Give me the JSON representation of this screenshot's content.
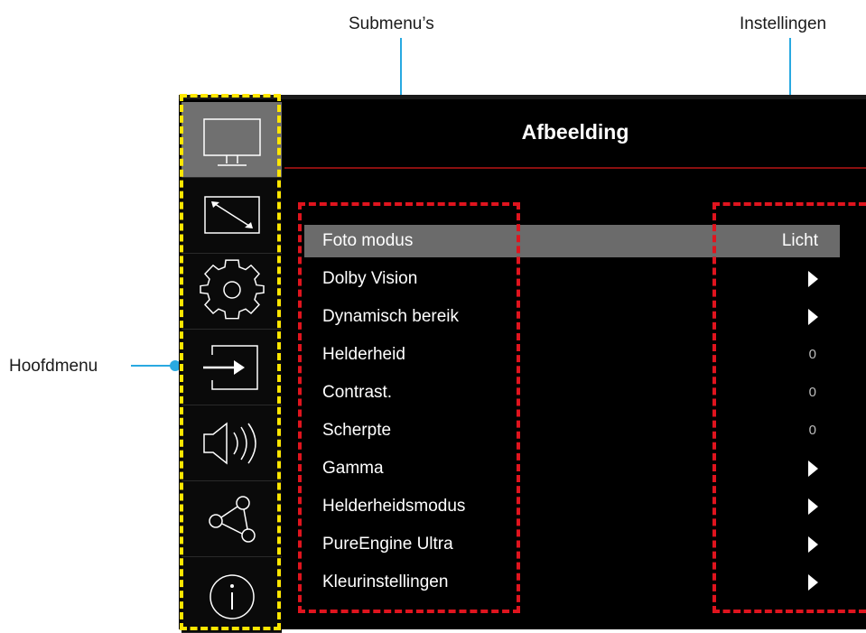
{
  "callouts": {
    "submenus": "Submenu’s",
    "settings": "Instellingen",
    "mainmenu": "Hoofdmenu"
  },
  "colors": {
    "callout": "#29a9e1",
    "mainmenu_frame": "#ffe600",
    "submenu_frame": "#e0141e",
    "selected_row": "#6b6b6b"
  },
  "sidebar": {
    "items": [
      {
        "icon": "monitor-icon",
        "active": true
      },
      {
        "icon": "resize-icon",
        "active": false
      },
      {
        "icon": "gear-icon",
        "active": false
      },
      {
        "icon": "input-icon",
        "active": false
      },
      {
        "icon": "speaker-icon",
        "active": false
      },
      {
        "icon": "network-icon",
        "active": false
      },
      {
        "icon": "info-icon",
        "active": false
      }
    ]
  },
  "menu": {
    "title": "Afbeelding",
    "rows": [
      {
        "label": "Foto modus",
        "value": "Licht",
        "selected": true
      },
      {
        "label": "Dolby Vision",
        "value": "arrow"
      },
      {
        "label": "Dynamisch bereik",
        "value": "arrow"
      },
      {
        "label": "Helderheid",
        "value": "0"
      },
      {
        "label": "Contrast.",
        "value": "0"
      },
      {
        "label": "Scherpte",
        "value": "0"
      },
      {
        "label": "Gamma",
        "value": "arrow"
      },
      {
        "label": "Helderheidsmodus",
        "value": "arrow"
      },
      {
        "label": "PureEngine Ultra",
        "value": "arrow"
      },
      {
        "label": "Kleurinstellingen",
        "value": "arrow"
      }
    ]
  }
}
